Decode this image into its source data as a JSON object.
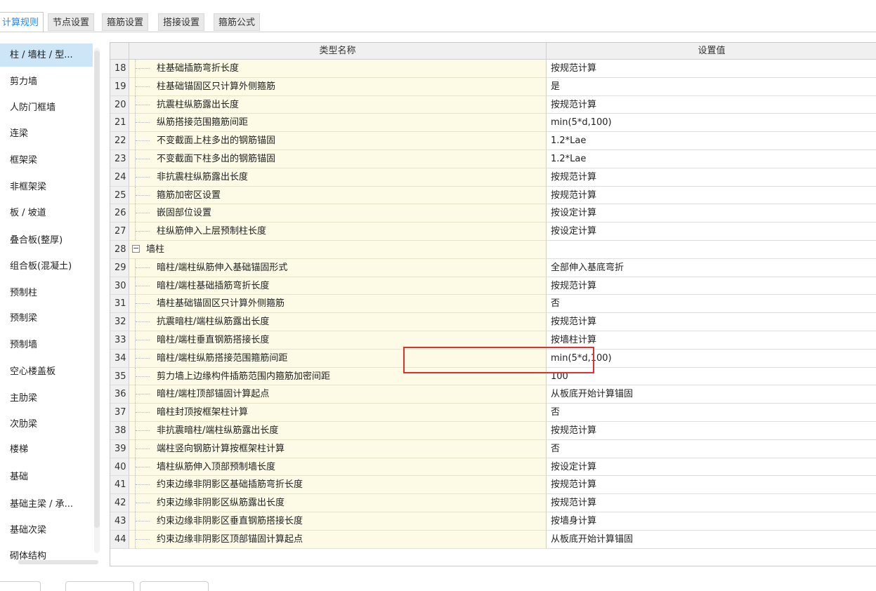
{
  "tabs": [
    "计算规则",
    "节点设置",
    "箍筋设置",
    "搭接设置",
    "箍筋公式"
  ],
  "active_tab": 0,
  "sidebar": {
    "items": [
      "柱 / 墙柱 / 型...",
      "剪力墙",
      "人防门框墙",
      "连梁",
      "框架梁",
      "非框架梁",
      "板 / 坡道",
      "叠合板(整厚)",
      "组合板(混凝土)",
      "预制柱",
      "预制梁",
      "预制墙",
      "空心楼盖板",
      "主肋梁",
      "次肋梁",
      "楼梯",
      "基础",
      "基础主梁 / 承...",
      "基础次梁",
      "砌体结构"
    ],
    "selected": 0
  },
  "grid": {
    "columns": [
      "",
      "类型名称",
      "设置值"
    ],
    "rows": [
      {
        "num": "18",
        "name": "柱基础插筋弯折长度",
        "value": "按规范计算"
      },
      {
        "num": "19",
        "name": "柱基础锚固区只计算外侧箍筋",
        "value": "是"
      },
      {
        "num": "20",
        "name": "抗震柱纵筋露出长度",
        "value": "按规范计算"
      },
      {
        "num": "21",
        "name": "纵筋搭接范围箍筋间距",
        "value": "min(5*d,100)"
      },
      {
        "num": "22",
        "name": "不变截面上柱多出的钢筋锚固",
        "value": "1.2*Lae"
      },
      {
        "num": "23",
        "name": "不变截面下柱多出的钢筋锚固",
        "value": "1.2*Lae"
      },
      {
        "num": "24",
        "name": "非抗震柱纵筋露出长度",
        "value": "按规范计算"
      },
      {
        "num": "25",
        "name": "箍筋加密区设置",
        "value": "按规范计算"
      },
      {
        "num": "26",
        "name": "嵌固部位设置",
        "value": "按设定计算"
      },
      {
        "num": "27",
        "name": "柱纵筋伸入上层预制柱长度",
        "value": "按设定计算"
      },
      {
        "num": "28",
        "name": "墙柱",
        "value": "",
        "group": true,
        "toggle": "−"
      },
      {
        "num": "29",
        "name": "暗柱/端柱纵筋伸入基础锚固形式",
        "value": "全部伸入基底弯折"
      },
      {
        "num": "30",
        "name": "暗柱/端柱基础插筋弯折长度",
        "value": "按规范计算"
      },
      {
        "num": "31",
        "name": "墙柱基础锚固区只计算外侧箍筋",
        "value": "否"
      },
      {
        "num": "32",
        "name": "抗震暗柱/端柱纵筋露出长度",
        "value": "按规范计算"
      },
      {
        "num": "33",
        "name": "暗柱/端柱垂直钢筋搭接长度",
        "value": "按墙柱计算"
      },
      {
        "num": "34",
        "name": "暗柱/端柱纵筋搭接范围箍筋间距",
        "value": "min(5*d,100)"
      },
      {
        "num": "35",
        "name": "剪力墙上边缘构件插筋范围内箍筋加密间距",
        "value": "100"
      },
      {
        "num": "36",
        "name": "暗柱/端柱顶部锚固计算起点",
        "value": "从板底开始计算锚固"
      },
      {
        "num": "37",
        "name": "暗柱封顶按框架柱计算",
        "value": "否"
      },
      {
        "num": "38",
        "name": "非抗震暗柱/端柱纵筋露出长度",
        "value": "按规范计算"
      },
      {
        "num": "39",
        "name": "端柱竖向钢筋计算按框架柱计算",
        "value": "否"
      },
      {
        "num": "40",
        "name": "墙柱纵筋伸入顶部预制墙长度",
        "value": "按设定计算"
      },
      {
        "num": "41",
        "name": "约束边缘非阴影区基础插筋弯折长度",
        "value": "按规范计算"
      },
      {
        "num": "42",
        "name": "约束边缘非阴影区纵筋露出长度",
        "value": "按规范计算"
      },
      {
        "num": "43",
        "name": "约束边缘非阴影区垂直钢筋搭接长度",
        "value": "按墙身计算"
      },
      {
        "num": "44",
        "name": "约束边缘非阴影区顶部锚固计算起点",
        "value": "从板底开始计算锚固"
      }
    ]
  },
  "colors": {
    "accent": "#2e8ad8",
    "selected_bg": "#cde6f7",
    "name_cell_bg": "#fdfbe6",
    "highlight_box": "#e42f2f"
  }
}
